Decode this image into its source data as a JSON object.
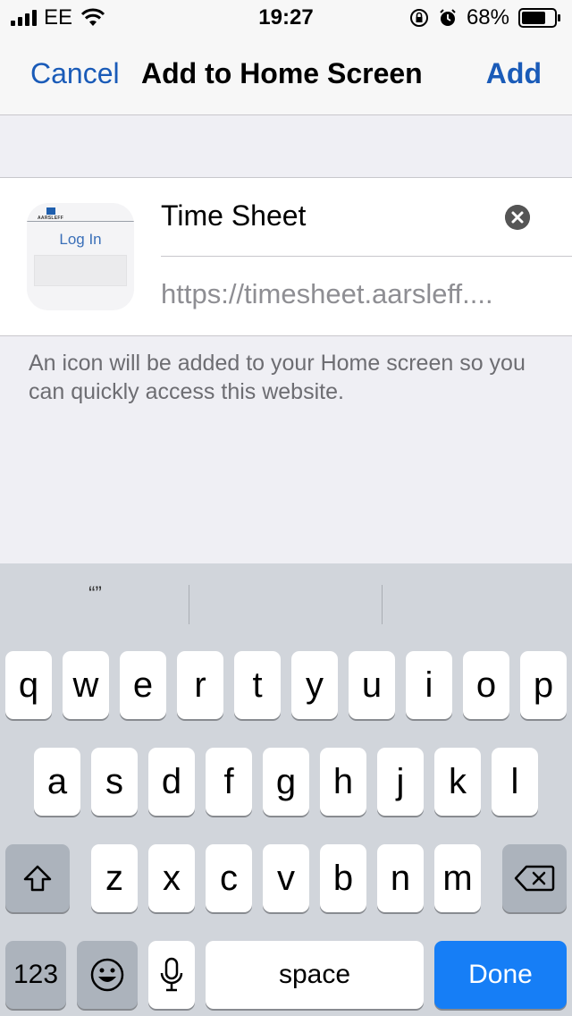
{
  "status_bar": {
    "carrier": "EE",
    "time": "19:27",
    "battery_percent": "68%"
  },
  "nav": {
    "cancel_label": "Cancel",
    "title": "Add to Home Screen",
    "add_label": "Add"
  },
  "bookmark": {
    "icon_brand": "AARSLEFF",
    "icon_login_label": "Log In",
    "name_value": "Time Sheet",
    "url": "https://timesheet.aarsleff...."
  },
  "footnote": "An icon will be added to your Home screen so you can quickly access this website.",
  "keyboard": {
    "suggestions": [
      "“”",
      "",
      ""
    ],
    "row1": [
      "q",
      "w",
      "e",
      "r",
      "t",
      "y",
      "u",
      "i",
      "o",
      "p"
    ],
    "row2": [
      "a",
      "s",
      "d",
      "f",
      "g",
      "h",
      "j",
      "k",
      "l"
    ],
    "row3": [
      "z",
      "x",
      "c",
      "v",
      "b",
      "n",
      "m"
    ],
    "numbers_label": "123",
    "space_label": "space",
    "done_label": "Done"
  },
  "colors": {
    "accent": "#1a5bb8",
    "done_key": "#167ef6",
    "background": "#efeff4"
  }
}
